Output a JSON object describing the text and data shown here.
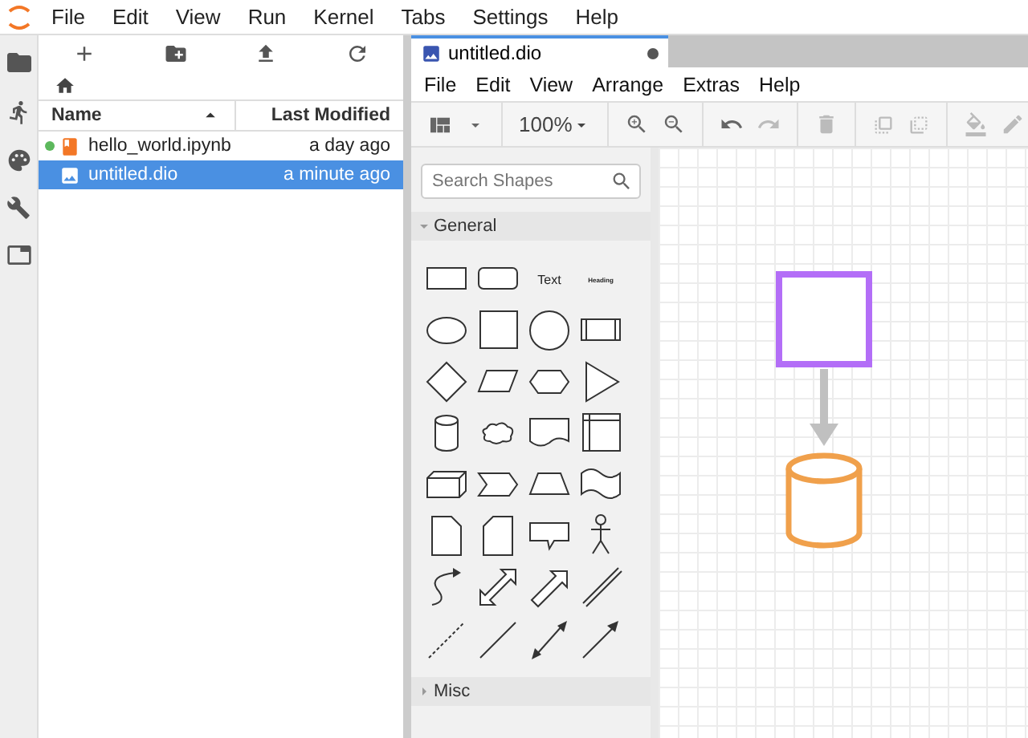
{
  "menu_bar": {
    "items": [
      "File",
      "Edit",
      "View",
      "Run",
      "Kernel",
      "Tabs",
      "Settings",
      "Help"
    ]
  },
  "file_browser": {
    "columns": [
      {
        "label": "Name",
        "sorted": true
      },
      {
        "label": "Last Modified",
        "sorted": false
      }
    ],
    "files": [
      {
        "name": "hello_world.ipynb",
        "modified": "a day ago",
        "kind": "notebook",
        "running": true,
        "selected": false
      },
      {
        "name": "untitled.dio",
        "modified": "a minute ago",
        "kind": "image",
        "running": false,
        "selected": true
      }
    ]
  },
  "editor_tab": {
    "title": "untitled.dio",
    "unsaved": true
  },
  "drawio": {
    "menu": [
      "File",
      "Edit",
      "View",
      "Arrange",
      "Extras",
      "Help"
    ],
    "zoom": "100%",
    "search": {
      "placeholder": "Search Shapes"
    },
    "sections": [
      {
        "title": "General",
        "expanded": true,
        "text_tiles": [
          "Text",
          "Heading"
        ]
      },
      {
        "title": "Misc",
        "expanded": false
      }
    ]
  }
}
